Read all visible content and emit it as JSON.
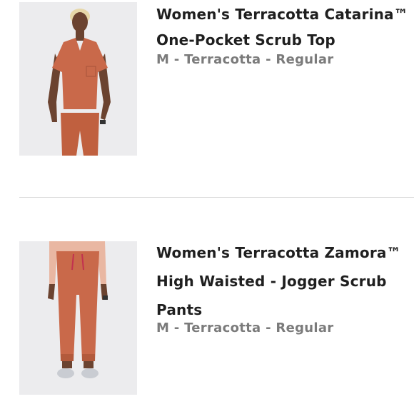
{
  "products": [
    {
      "title_lines": [
        "Women's Terracotta Catarina™",
        "One-Pocket Scrub Top"
      ],
      "variant": "M - Terracotta - Regular",
      "image_icon": "scrub-top-photo"
    },
    {
      "title_lines": [
        "Women's Terracotta Zamora™",
        "High Waisted - Jogger Scrub",
        "Pants"
      ],
      "variant": "M - Terracotta - Regular",
      "image_icon": "scrub-pants-photo"
    }
  ],
  "colors": {
    "terracotta": "#c9694a",
    "title_text": "#1f1f1f",
    "variant_text": "#7b7b7b",
    "image_background": "#ececee",
    "divider": "#dadada"
  }
}
